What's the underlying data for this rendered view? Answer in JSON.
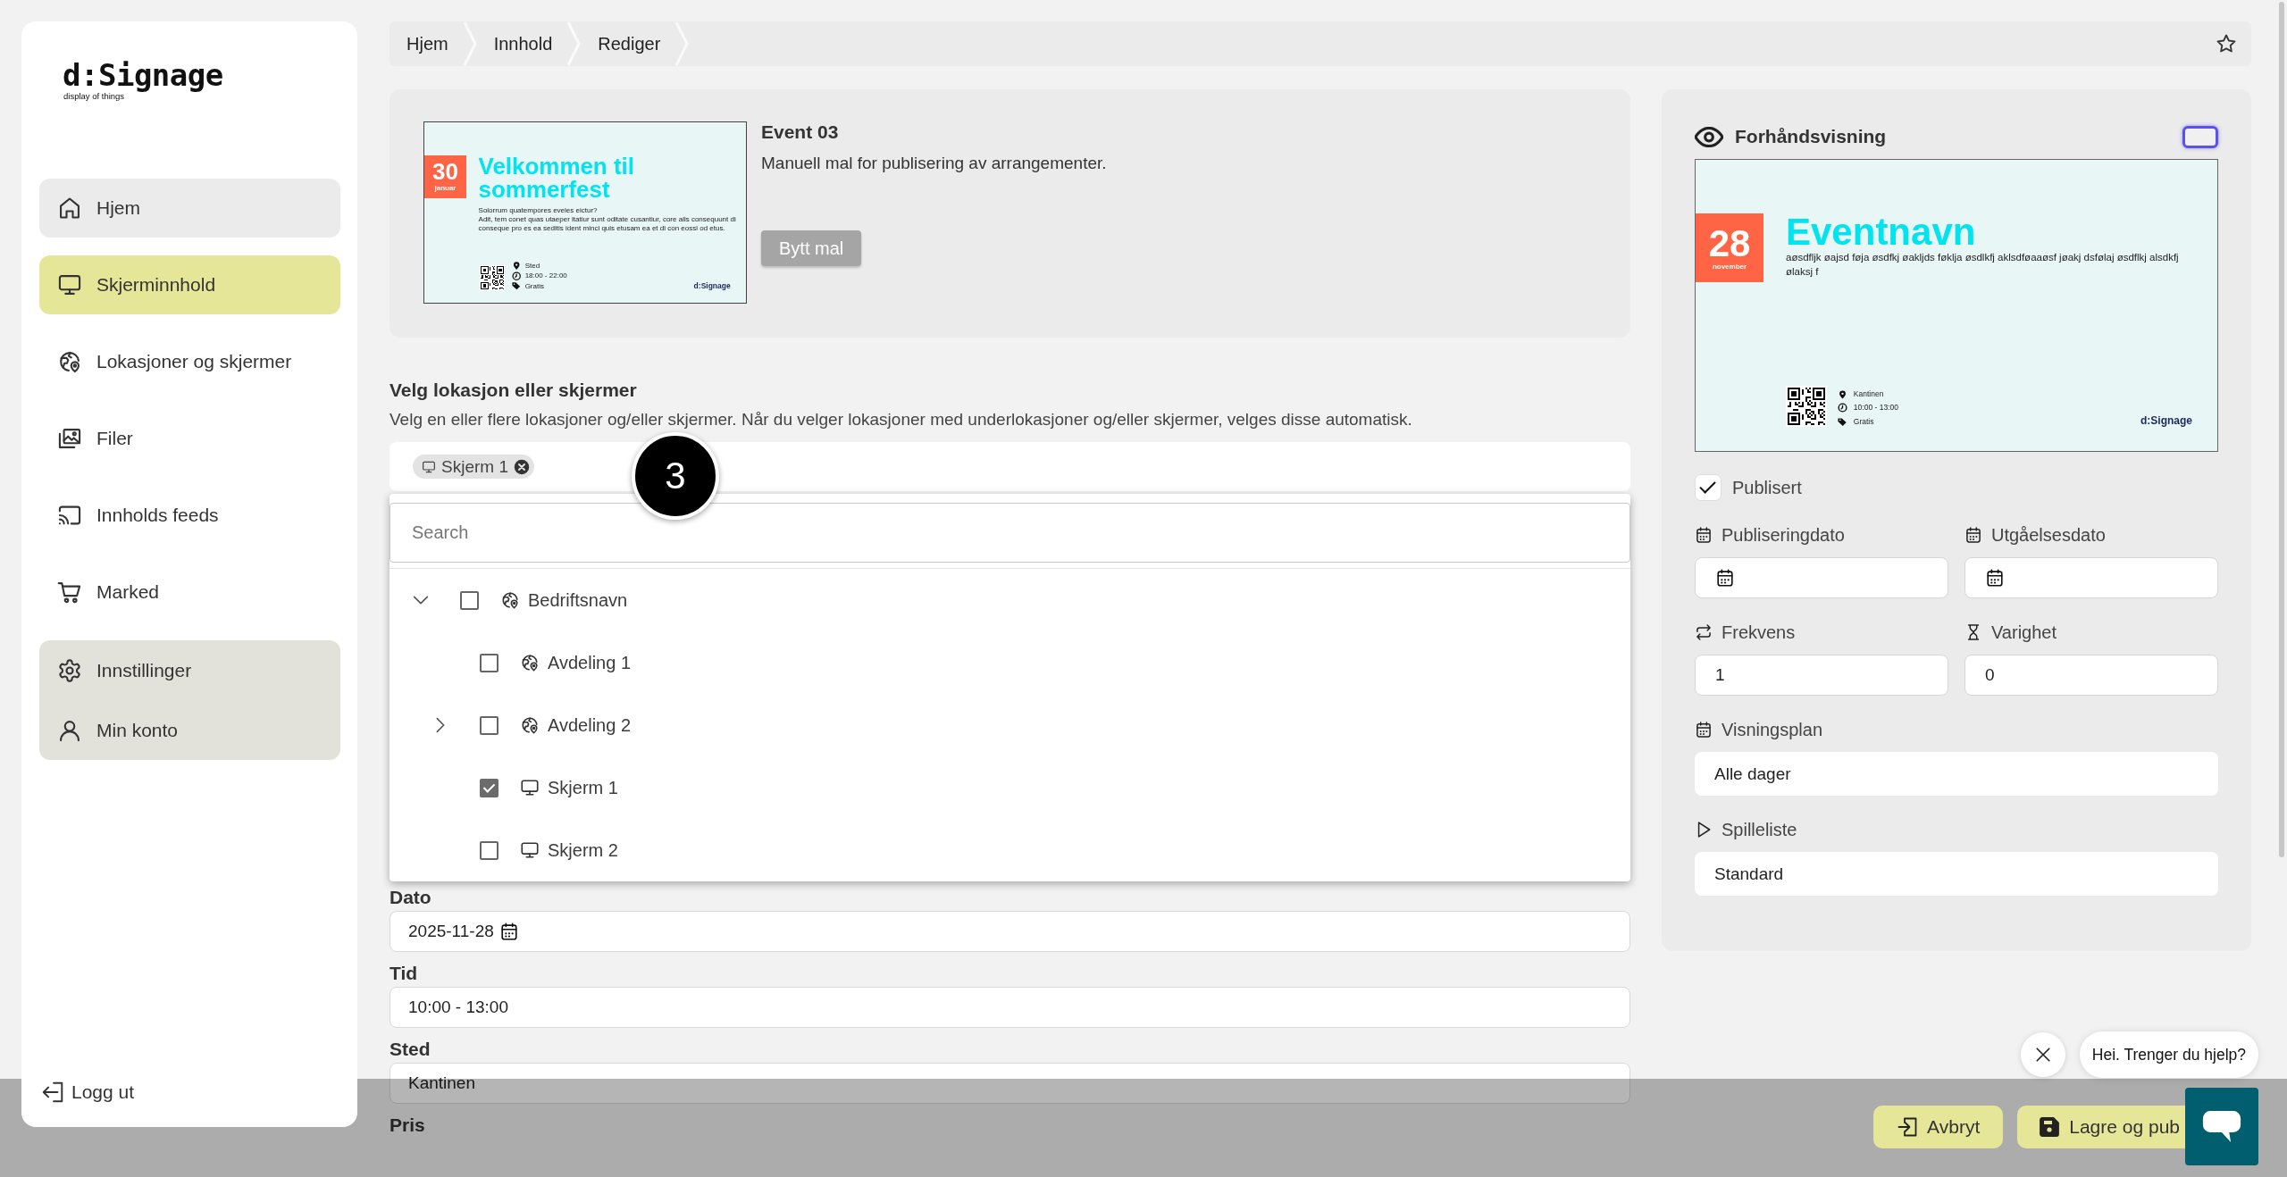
{
  "sidebar": {
    "logo": "d:Signage",
    "tagline": "display of things",
    "nav": [
      {
        "label": "Hjem",
        "selected": false,
        "highlighted": true
      },
      {
        "label": "Skjerminnhold",
        "selected": true,
        "highlighted": false
      },
      {
        "label": "Lokasjoner og skjermer",
        "selected": false,
        "highlighted": false
      },
      {
        "label": "Filer",
        "selected": false,
        "highlighted": false
      },
      {
        "label": "Innholds feeds",
        "selected": false,
        "highlighted": false
      },
      {
        "label": "Marked",
        "selected": false,
        "highlighted": false
      }
    ],
    "account_menu": [
      {
        "label": "Innstillinger"
      },
      {
        "label": "Min konto"
      }
    ],
    "logout": "Logg ut"
  },
  "breadcrumbs": [
    "Hjem",
    "Innhold",
    "Rediger"
  ],
  "template": {
    "thumbnail": {
      "day": "30",
      "month": "januar",
      "heading": "Velkommen til sommerfest",
      "subheading": "Solorrum quatempores eveles eictur?",
      "body": "Adit, tem conet quas utaeper itatiur sunt oditate cusantiur, core alis consequunt di conseque pro es ea seditis ident minci quis etusam ea et di con eossi od etus.",
      "details": [
        "Sted",
        "18:00 - 22:00",
        "Gratis"
      ],
      "logo": "d:Signage"
    },
    "title": "Event 03",
    "description": "Manuell mal for publisering av arrangementer.",
    "button": "Bytt mal"
  },
  "location_select": {
    "label": "Velg lokasjon eller skjermer",
    "help": "Velg en eller flere lokasjoner og/eller skjermer. Når du velger lokasjoner med underlokasjoner og/eller skjermer, velges disse automatisk.",
    "chips": [
      {
        "label": "Skjerm 1"
      }
    ],
    "search_placeholder": "Search",
    "tree": [
      {
        "label": "Bedriftsnavn",
        "kind": "location",
        "checked": false,
        "expandable": true,
        "expanded": true,
        "children": [
          {
            "label": "Avdeling 1",
            "kind": "location",
            "checked": false,
            "expandable": false,
            "expanded": false
          },
          {
            "label": "Avdeling 2",
            "kind": "location",
            "checked": false,
            "expandable": true,
            "expanded": false
          },
          {
            "label": "Skjerm 1",
            "kind": "screen",
            "checked": true,
            "expandable": false,
            "expanded": false
          },
          {
            "label": "Skjerm 2",
            "kind": "screen",
            "checked": false,
            "expandable": false,
            "expanded": false
          }
        ]
      }
    ]
  },
  "step_marker": "3",
  "fields": [
    {
      "label": "Dato",
      "kind": "date",
      "value": "2025-11-28"
    },
    {
      "label": "Tid",
      "kind": "text",
      "value": "10:00 - 13:00"
    },
    {
      "label": "Sted",
      "kind": "text",
      "value": "Kantinen"
    },
    {
      "label": "Pris"
    }
  ],
  "preview": {
    "title": "Forhåndsvisning",
    "slide": {
      "day": "28",
      "month": "november",
      "heading": "Eventnavn",
      "body": "aøsdfljk øajsd føja øsdfkj øakljds føklja øsdlkfj aklsdføaaøsf jøakj dsfølaj øsdflkj alsdkfj ølaksj f",
      "details": [
        "Kantinen",
        "10:00 - 13:00",
        "Gratis"
      ],
      "logo": "d:Signage"
    },
    "published": {
      "label": "Publisert",
      "checked": true
    },
    "field_rows": [
      [
        {
          "label": "Publiseringdato",
          "kind": "date"
        },
        {
          "label": "Utgåelsesdato",
          "kind": "date"
        }
      ],
      [
        {
          "label": "Frekvens",
          "kind": "number",
          "value": "1"
        },
        {
          "label": "Varighet",
          "kind": "number",
          "value": "0"
        }
      ],
      [
        {
          "label": "Visningsplan",
          "kind": "select",
          "value": "Alle dager"
        }
      ],
      [
        {
          "label": "Spilleliste",
          "kind": "select",
          "value": "Standard"
        }
      ]
    ]
  },
  "footer": {
    "buttons": [
      {
        "label": "Avbryt"
      },
      {
        "label": "Lagre og pub"
      }
    ]
  },
  "chat": {
    "greeting": "Hei. Trenger du hjelp?"
  }
}
